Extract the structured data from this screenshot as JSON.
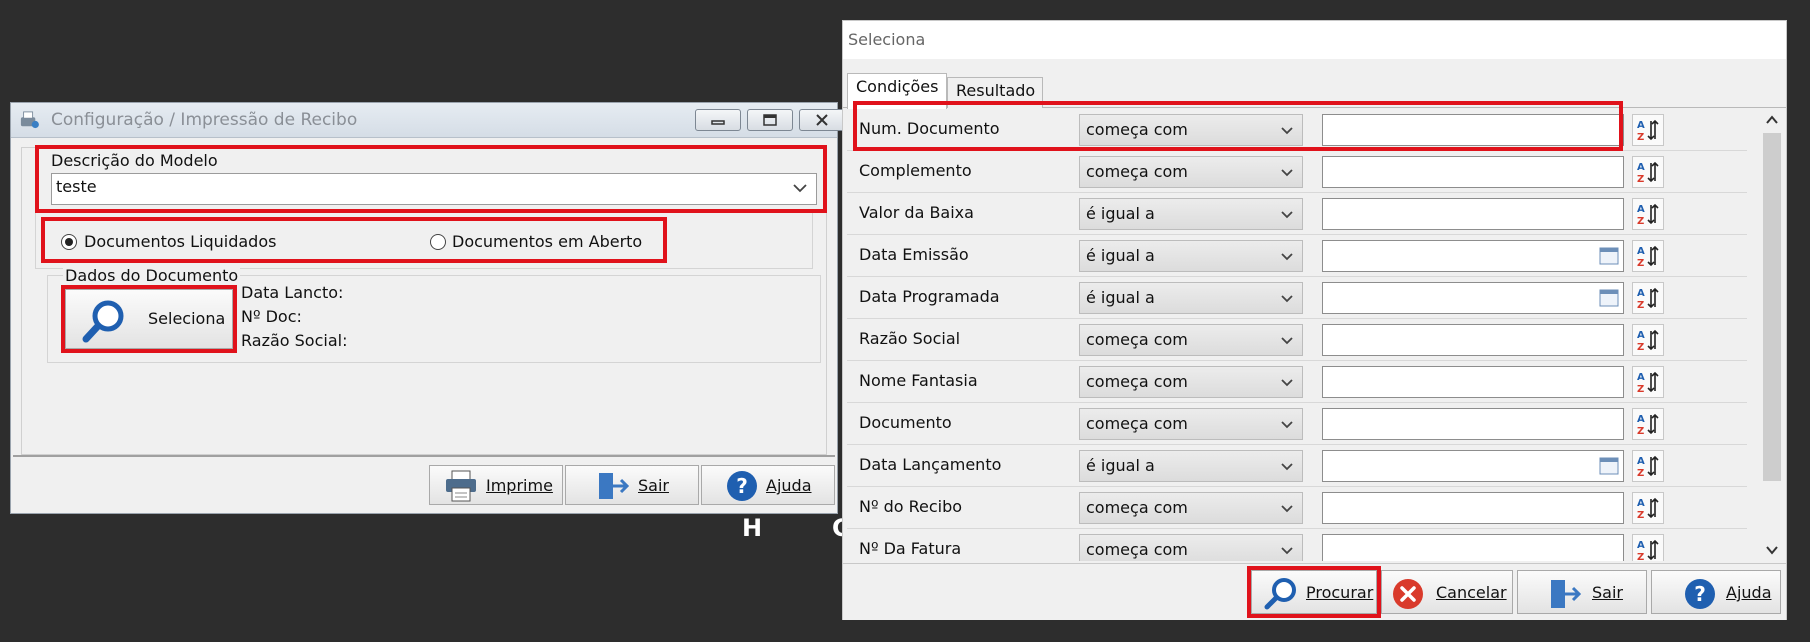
{
  "bg_chars": [
    "H",
    "C"
  ],
  "left_window": {
    "title": "Configuração / Impressão de Recibo",
    "descricao_label": "Descrição do Modelo",
    "descricao_value": "teste",
    "radio_liquidados": "Documentos Liquidados",
    "radio_aberto": "Documentos em Aberto",
    "dados_group": "Dados do Documento",
    "seleciona_label": "Seleciona",
    "data_lancto": "Data Lancto:",
    "num_doc": "Nº Doc:",
    "razao_social": "Razão Social:",
    "btn_imprime": "Imprime",
    "btn_sair": "Sair",
    "btn_ajuda": "Ajuda"
  },
  "right_window": {
    "title": "Seleciona",
    "tabs": [
      "Condições",
      "Resultado"
    ],
    "rows": [
      {
        "field": "Num. Documento",
        "op": "começa com",
        "calendar": false
      },
      {
        "field": "Complemento",
        "op": "começa com",
        "calendar": false
      },
      {
        "field": "Valor da Baixa",
        "op": "é igual a",
        "calendar": false
      },
      {
        "field": "Data Emissão",
        "op": "é igual a",
        "calendar": true
      },
      {
        "field": "Data Programada",
        "op": "é igual a",
        "calendar": true
      },
      {
        "field": "Razão Social",
        "op": "começa com",
        "calendar": false
      },
      {
        "field": "Nome Fantasia",
        "op": "começa com",
        "calendar": false
      },
      {
        "field": "Documento",
        "op": "começa com",
        "calendar": false
      },
      {
        "field": "Data Lançamento",
        "op": "é igual a",
        "calendar": true
      },
      {
        "field": "Nº do Recibo",
        "op": "começa com",
        "calendar": false
      },
      {
        "field": "Nº Da Fatura",
        "op": "começa com",
        "calendar": false
      }
    ],
    "btn_procurar": "Procurar",
    "btn_cancelar": "Cancelar",
    "btn_sair": "Sair",
    "btn_ajuda": "Ajuda"
  },
  "colors": {
    "highlight": "#e0121b",
    "help_blue": "#1f5fb0",
    "cancel_red": "#d93a2b"
  }
}
